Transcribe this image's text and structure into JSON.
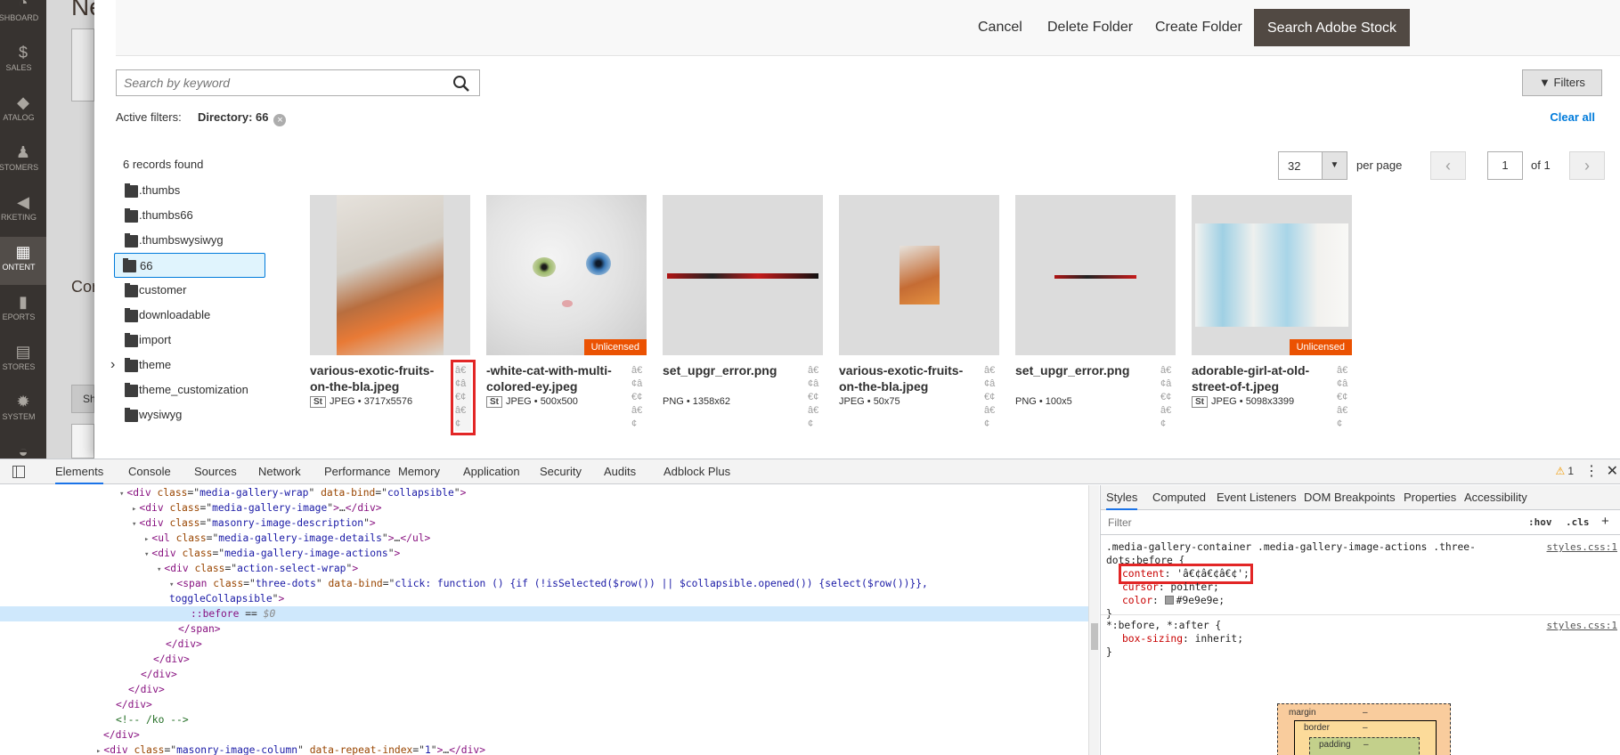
{
  "admin_nav": [
    {
      "label": "SHBOARD",
      "icon": "dashboard-icon",
      "glyph": "◔"
    },
    {
      "label": "SALES",
      "icon": "dollar-icon",
      "glyph": "$"
    },
    {
      "label": "ATALOG",
      "icon": "cube-icon",
      "glyph": "◆"
    },
    {
      "label": "STOMERS",
      "icon": "person-icon",
      "glyph": "♟"
    },
    {
      "label": "RKETING",
      "icon": "megaphone-icon",
      "glyph": "◀"
    },
    {
      "label": "ONTENT",
      "icon": "layout-icon",
      "glyph": "▦"
    },
    {
      "label": "EPORTS",
      "icon": "bar-chart-icon",
      "glyph": "▮"
    },
    {
      "label": "STORES",
      "icon": "store-icon",
      "glyph": "▤"
    },
    {
      "label": "SYSTEM",
      "icon": "gear-icon",
      "glyph": "✹"
    },
    {
      "label": "",
      "icon": "puzzle-icon",
      "glyph": "◒"
    }
  ],
  "background": {
    "title": "Ne",
    "content_heading": "Con",
    "button_fragment": "Sh"
  },
  "modal": {
    "buttons": {
      "cancel": "Cancel",
      "delete_folder": "Delete Folder",
      "create_folder": "Create Folder",
      "search_stock": "Search Adobe Stock"
    },
    "search_placeholder": "Search by keyword",
    "filters_label": "Filters",
    "active_filters_label": "Active filters:",
    "active_filter_chip": "Directory: 66",
    "clear_all": "Clear all",
    "records_found": "6 records found",
    "per_page_value": "32",
    "per_page_label": "per page",
    "page_input": "1",
    "page_of": "of 1"
  },
  "folders": [
    {
      "name": ".thumbs",
      "selected": false,
      "expandable": false
    },
    {
      "name": ".thumbs66",
      "selected": false,
      "expandable": false
    },
    {
      "name": ".thumbswysiwyg",
      "selected": false,
      "expandable": false
    },
    {
      "name": "66",
      "selected": true,
      "expandable": false
    },
    {
      "name": "customer",
      "selected": false,
      "expandable": false
    },
    {
      "name": "downloadable",
      "selected": false,
      "expandable": false
    },
    {
      "name": "import",
      "selected": false,
      "expandable": false
    },
    {
      "name": "theme",
      "selected": false,
      "expandable": true
    },
    {
      "name": "theme_customization",
      "selected": false,
      "expandable": false
    },
    {
      "name": "wysiwyg",
      "selected": false,
      "expandable": false
    }
  ],
  "images": [
    {
      "name": "various-exotic-fruits-on-the-bla.jpeg",
      "stock": "St",
      "meta": "JPEG • 3717x5576",
      "badge": "",
      "dots": "â€¢â€¢â€¢",
      "highlighted": true
    },
    {
      "name": "-white-cat-with-multi-colored-ey.jpeg",
      "stock": "St",
      "meta": "JPEG • 500x500",
      "badge": "Unlicensed",
      "dots": "â€¢â€¢â€¢",
      "highlighted": false
    },
    {
      "name": "set_upgr_error.png",
      "stock": "",
      "meta": "PNG • 1358x62",
      "badge": "",
      "dots": "â€¢â€¢â€¢",
      "highlighted": false
    },
    {
      "name": "various-exotic-fruits-on-the-bla.jpeg",
      "stock": "",
      "meta": "JPEG • 50x75",
      "badge": "",
      "dots": "â€¢â€¢â€¢",
      "highlighted": false
    },
    {
      "name": "set_upgr_error.png",
      "stock": "",
      "meta": "PNG • 100x5",
      "badge": "",
      "dots": "â€¢â€¢â€¢",
      "highlighted": false
    },
    {
      "name": "adorable-girl-at-old-street-of-t.jpeg",
      "stock": "St",
      "meta": "JPEG • 5098x3399",
      "badge": "Unlicensed",
      "dots": "â€¢â€¢â€¢",
      "highlighted": false
    }
  ],
  "devtools": {
    "tabs": [
      "Elements",
      "Console",
      "Sources",
      "Network",
      "Performance",
      "Memory",
      "Application",
      "Security",
      "Audits",
      "Adblock Plus"
    ],
    "warnings": "1",
    "styles_tabs": [
      "Styles",
      "Computed",
      "Event Listeners",
      "DOM Breakpoints",
      "Properties",
      "Accessibility"
    ],
    "filter_placeholder": "Filter",
    "hov": ":hov",
    "cls": ".cls",
    "dom_lines": [
      {
        "indent": 134,
        "tri": "▾",
        "parts": [
          [
            "t",
            "<div "
          ],
          [
            "an",
            "class"
          ],
          [
            "eq",
            "=\""
          ],
          [
            "av",
            "media-gallery-wrap"
          ],
          [
            "eq",
            "\" "
          ],
          [
            "an",
            "data-bind"
          ],
          [
            "eq",
            "=\""
          ],
          [
            "av",
            "collapsible"
          ],
          [
            "eq",
            "\""
          ],
          [
            "t",
            ">"
          ]
        ]
      },
      {
        "indent": 148,
        "tri": "▸",
        "parts": [
          [
            "t",
            "<div "
          ],
          [
            "an",
            "class"
          ],
          [
            "eq",
            "=\""
          ],
          [
            "av",
            "media-gallery-image"
          ],
          [
            "eq",
            "\""
          ],
          [
            "t",
            ">"
          ],
          [
            "eq",
            "…"
          ],
          [
            "t",
            "</div>"
          ]
        ]
      },
      {
        "indent": 148,
        "tri": "▾",
        "parts": [
          [
            "t",
            "<div "
          ],
          [
            "an",
            "class"
          ],
          [
            "eq",
            "=\""
          ],
          [
            "av",
            "masonry-image-description"
          ],
          [
            "eq",
            "\""
          ],
          [
            "t",
            ">"
          ]
        ]
      },
      {
        "indent": 162,
        "tri": "▸",
        "parts": [
          [
            "t",
            "<ul "
          ],
          [
            "an",
            "class"
          ],
          [
            "eq",
            "=\""
          ],
          [
            "av",
            "media-gallery-image-details"
          ],
          [
            "eq",
            "\""
          ],
          [
            "t",
            ">"
          ],
          [
            "eq",
            "…"
          ],
          [
            "t",
            "</ul>"
          ]
        ]
      },
      {
        "indent": 162,
        "tri": "▾",
        "parts": [
          [
            "t",
            "<div "
          ],
          [
            "an",
            "class"
          ],
          [
            "eq",
            "=\""
          ],
          [
            "av",
            "media-gallery-image-actions"
          ],
          [
            "eq",
            "\""
          ],
          [
            "t",
            ">"
          ]
        ]
      },
      {
        "indent": 176,
        "tri": "▾",
        "parts": [
          [
            "t",
            "<div "
          ],
          [
            "an",
            "class"
          ],
          [
            "eq",
            "=\""
          ],
          [
            "av",
            "action-select-wrap"
          ],
          [
            "eq",
            "\""
          ],
          [
            "t",
            ">"
          ]
        ]
      },
      {
        "indent": 190,
        "tri": "▾",
        "parts": [
          [
            "t",
            "<span "
          ],
          [
            "an",
            "class"
          ],
          [
            "eq",
            "=\""
          ],
          [
            "av",
            "three-dots"
          ],
          [
            "eq",
            "\" "
          ],
          [
            "an",
            "data-bind"
          ],
          [
            "eq",
            "=\""
          ],
          [
            "av",
            "click: function () {if (!isSelected($row()) || $collapsible.opened()) {select($row())}},"
          ]
        ]
      },
      {
        "indent": 190,
        "tri": "",
        "parts": [
          [
            "av",
            "toggleCollapsible"
          ],
          [
            "eq",
            "\""
          ],
          [
            "t",
            ">"
          ]
        ]
      },
      {
        "indent": 214,
        "tri": "",
        "selected": true,
        "parts": [
          [
            "ps",
            "::before"
          ],
          [
            "eq",
            " == "
          ],
          [
            "d0",
            "$0"
          ]
        ]
      },
      {
        "indent": 200,
        "tri": "",
        "parts": [
          [
            "t",
            "</span>"
          ]
        ]
      },
      {
        "indent": 186,
        "tri": "",
        "parts": [
          [
            "t",
            "</div>"
          ]
        ]
      },
      {
        "indent": 172,
        "tri": "",
        "parts": [
          [
            "t",
            "</div>"
          ]
        ]
      },
      {
        "indent": 158,
        "tri": "",
        "parts": [
          [
            "t",
            "</div>"
          ]
        ]
      },
      {
        "indent": 144,
        "tri": "",
        "parts": [
          [
            "t",
            "</div>"
          ]
        ]
      },
      {
        "indent": 130,
        "tri": "",
        "parts": [
          [
            "t",
            "</div>"
          ]
        ]
      },
      {
        "indent": 130,
        "tri": "",
        "parts": [
          [
            "cm",
            "<!-- /ko -->"
          ]
        ]
      },
      {
        "indent": 116,
        "tri": "",
        "parts": [
          [
            "t",
            "</div>"
          ]
        ]
      },
      {
        "indent": 108,
        "tri": "▸",
        "parts": [
          [
            "t",
            "<div "
          ],
          [
            "an",
            "class"
          ],
          [
            "eq",
            "=\""
          ],
          [
            "av",
            "masonry-image-column"
          ],
          [
            "eq",
            "\" "
          ],
          [
            "an",
            "data-repeat-index"
          ],
          [
            "eq",
            "=\""
          ],
          [
            "av",
            "1"
          ],
          [
            "eq",
            "\""
          ],
          [
            "t",
            ">"
          ],
          [
            "eq",
            "…"
          ],
          [
            "t",
            "</div>"
          ]
        ]
      }
    ],
    "rule1_selector": ".media-gallery-container .media-gallery-image-actions .three-dots:before {",
    "rule1_src": "styles.css:1",
    "rule1_decls": [
      {
        "prop": "content",
        "value": "'â€¢â€¢â€¢';",
        "highlight": true
      },
      {
        "prop": "cursor",
        "value": "pointer;",
        "highlight": false
      },
      {
        "prop": "color",
        "value": "#9e9e9e;",
        "highlight": false,
        "swatch": "#9e9e9e"
      }
    ],
    "rule2_selector": "*:before, *:after {",
    "rule2_src": "styles.css:1",
    "rule2_decls": [
      {
        "prop": "box-sizing",
        "value": "inherit;",
        "highlight": false
      }
    ],
    "close_brace": "}",
    "box_model": {
      "margin": "margin",
      "border": "border",
      "padding": "padding",
      "dash": "–"
    }
  }
}
